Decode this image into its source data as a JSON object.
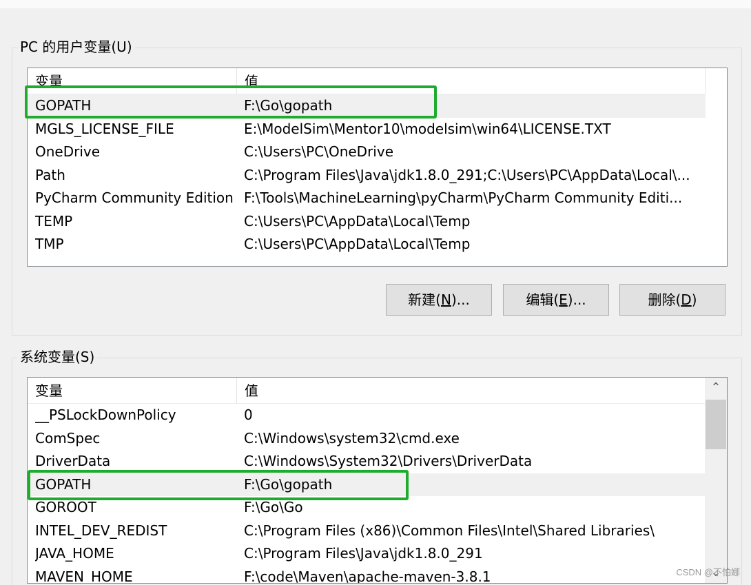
{
  "user_vars": {
    "title": "PC 的用户变量(U)",
    "col_name": "变量",
    "col_value": "值",
    "rows": [
      {
        "name": "GOPATH",
        "value": "F:\\Go\\gopath"
      },
      {
        "name": "MGLS_LICENSE_FILE",
        "value": "E:\\ModelSim\\Mentor10\\modelsim\\win64\\LICENSE.TXT"
      },
      {
        "name": "OneDrive",
        "value": "C:\\Users\\PC\\OneDrive"
      },
      {
        "name": "Path",
        "value": "C:\\Program Files\\Java\\jdk1.8.0_291;C:\\Users\\PC\\AppData\\Local\\..."
      },
      {
        "name": "PyCharm Community Edition",
        "value": "F:\\Tools\\MachineLearning\\pyCharm\\PyCharm Community Editi..."
      },
      {
        "name": "TEMP",
        "value": "C:\\Users\\PC\\AppData\\Local\\Temp"
      },
      {
        "name": "TMP",
        "value": "C:\\Users\\PC\\AppData\\Local\\Temp"
      }
    ]
  },
  "buttons": {
    "new_prefix": "新建(",
    "new_key": "N",
    "new_suffix": ")...",
    "edit_prefix": "编辑(",
    "edit_key": "E",
    "edit_suffix": ")...",
    "delete_prefix": "删除(",
    "delete_key": "D",
    "delete_suffix": ")"
  },
  "system_vars": {
    "title": "系统变量(S)",
    "col_name": "变量",
    "col_value": "值",
    "rows": [
      {
        "name": "__PSLockDownPolicy",
        "value": "0"
      },
      {
        "name": "ComSpec",
        "value": "C:\\Windows\\system32\\cmd.exe"
      },
      {
        "name": "DriverData",
        "value": "C:\\Windows\\System32\\Drivers\\DriverData"
      },
      {
        "name": "GOPATH",
        "value": "F:\\Go\\gopath"
      },
      {
        "name": "GOROOT",
        "value": "F:\\Go\\Go"
      },
      {
        "name": "INTEL_DEV_REDIST",
        "value": "C:\\Program Files (x86)\\Common Files\\Intel\\Shared Libraries\\"
      },
      {
        "name": "JAVA_HOME",
        "value": "C:\\Program Files\\Java\\jdk1.8.0_291"
      },
      {
        "name": "MAVEN_HOME",
        "value": "F:\\code\\Maven\\apache-maven-3.8.1"
      }
    ]
  },
  "scroll": {
    "up_icon": "chevron-up-icon",
    "down_icon": "chevron-down-icon"
  },
  "highlight_color": "#1fab2d",
  "watermark": "CSDN @不怕娜"
}
